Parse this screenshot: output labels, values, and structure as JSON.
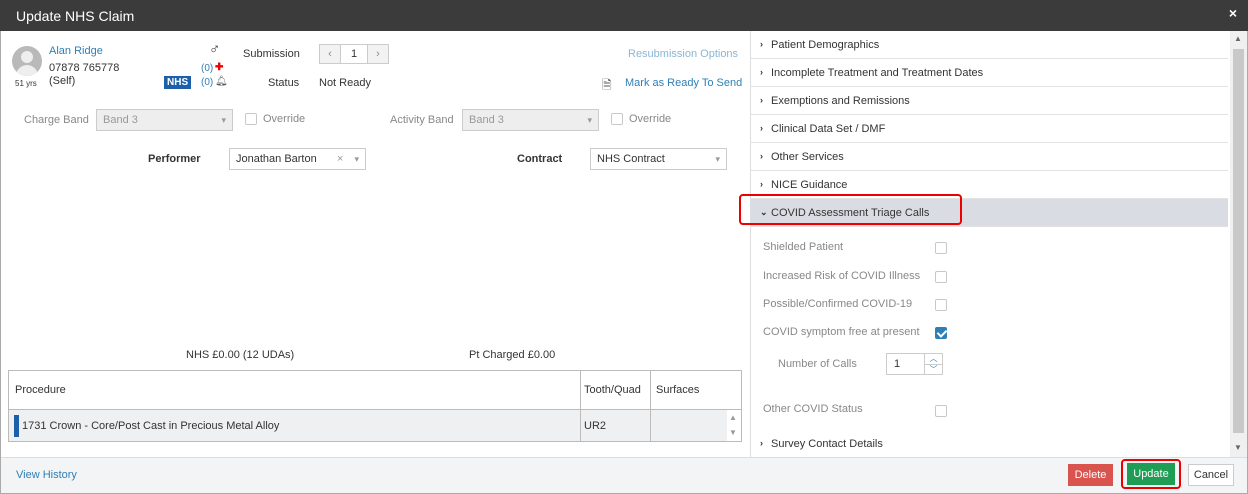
{
  "window": {
    "title": "Update NHS Claim",
    "close": "×"
  },
  "patient": {
    "name": "Alan Ridge",
    "phone": "07878 765778",
    "relation": "(Self)",
    "age": "51 yrs",
    "gender_symbol": "♂",
    "badge": "NHS",
    "alerts_count": "(0)",
    "notes_count": "(0)"
  },
  "submission": {
    "label": "Submission",
    "value": "1",
    "prev": "‹",
    "next": "›",
    "resubmission_link": "Resubmission Options",
    "status_label": "Status",
    "status_value": "Not Ready",
    "mark_ready_link": "Mark as Ready To Send"
  },
  "bands": {
    "charge_band_label": "Charge Band",
    "charge_band_value": "Band 3",
    "override_label": "Override",
    "activity_band_label": "Activity Band",
    "activity_band_value": "Band 3",
    "activity_override_label": "Override"
  },
  "assignment": {
    "performer_label": "Performer",
    "performer_value": "Jonathan Barton",
    "contract_label": "Contract",
    "contract_value": "NHS Contract"
  },
  "totals": {
    "nhs": "NHS £0.00 (12 UDAs)",
    "pt_charged": "Pt Charged £0.00"
  },
  "procedures": {
    "headers": [
      "Procedure",
      "Tooth/Quad",
      "Surfaces"
    ],
    "rows": [
      {
        "procedure": "1731 Crown - Core/Post Cast in Precious Metal Alloy",
        "tooth": "UR2",
        "surfaces": ""
      }
    ]
  },
  "sections": [
    "Patient Demographics",
    "Incomplete Treatment and Treatment Dates",
    "Exemptions and Remissions",
    "Clinical Data Set / DMF",
    "Other Services",
    "NICE Guidance",
    "COVID Assessment Triage Calls",
    "Survey Contact Details"
  ],
  "covid": {
    "shielded": {
      "label": "Shielded Patient",
      "checked": false
    },
    "increased_risk": {
      "label": "Increased Risk of COVID Illness",
      "checked": false
    },
    "possible_confirmed": {
      "label": "Possible/Confirmed COVID-19",
      "checked": false
    },
    "symptom_free": {
      "label": "COVID symptom free at present",
      "checked": true
    },
    "number_of_calls_label": "Number of Calls",
    "number_of_calls_value": "1",
    "other_status": {
      "label": "Other COVID Status",
      "checked": false
    }
  },
  "footer": {
    "view_history": "View History",
    "delete": "Delete",
    "update": "Update",
    "cancel": "Cancel"
  },
  "colors": {
    "titlebar": "#3b3b3b",
    "link": "#2f7fb7",
    "delete": "#d9534f",
    "update": "#1f9d55",
    "highlight": "#ee0000",
    "active_section": "#d9dde3"
  }
}
